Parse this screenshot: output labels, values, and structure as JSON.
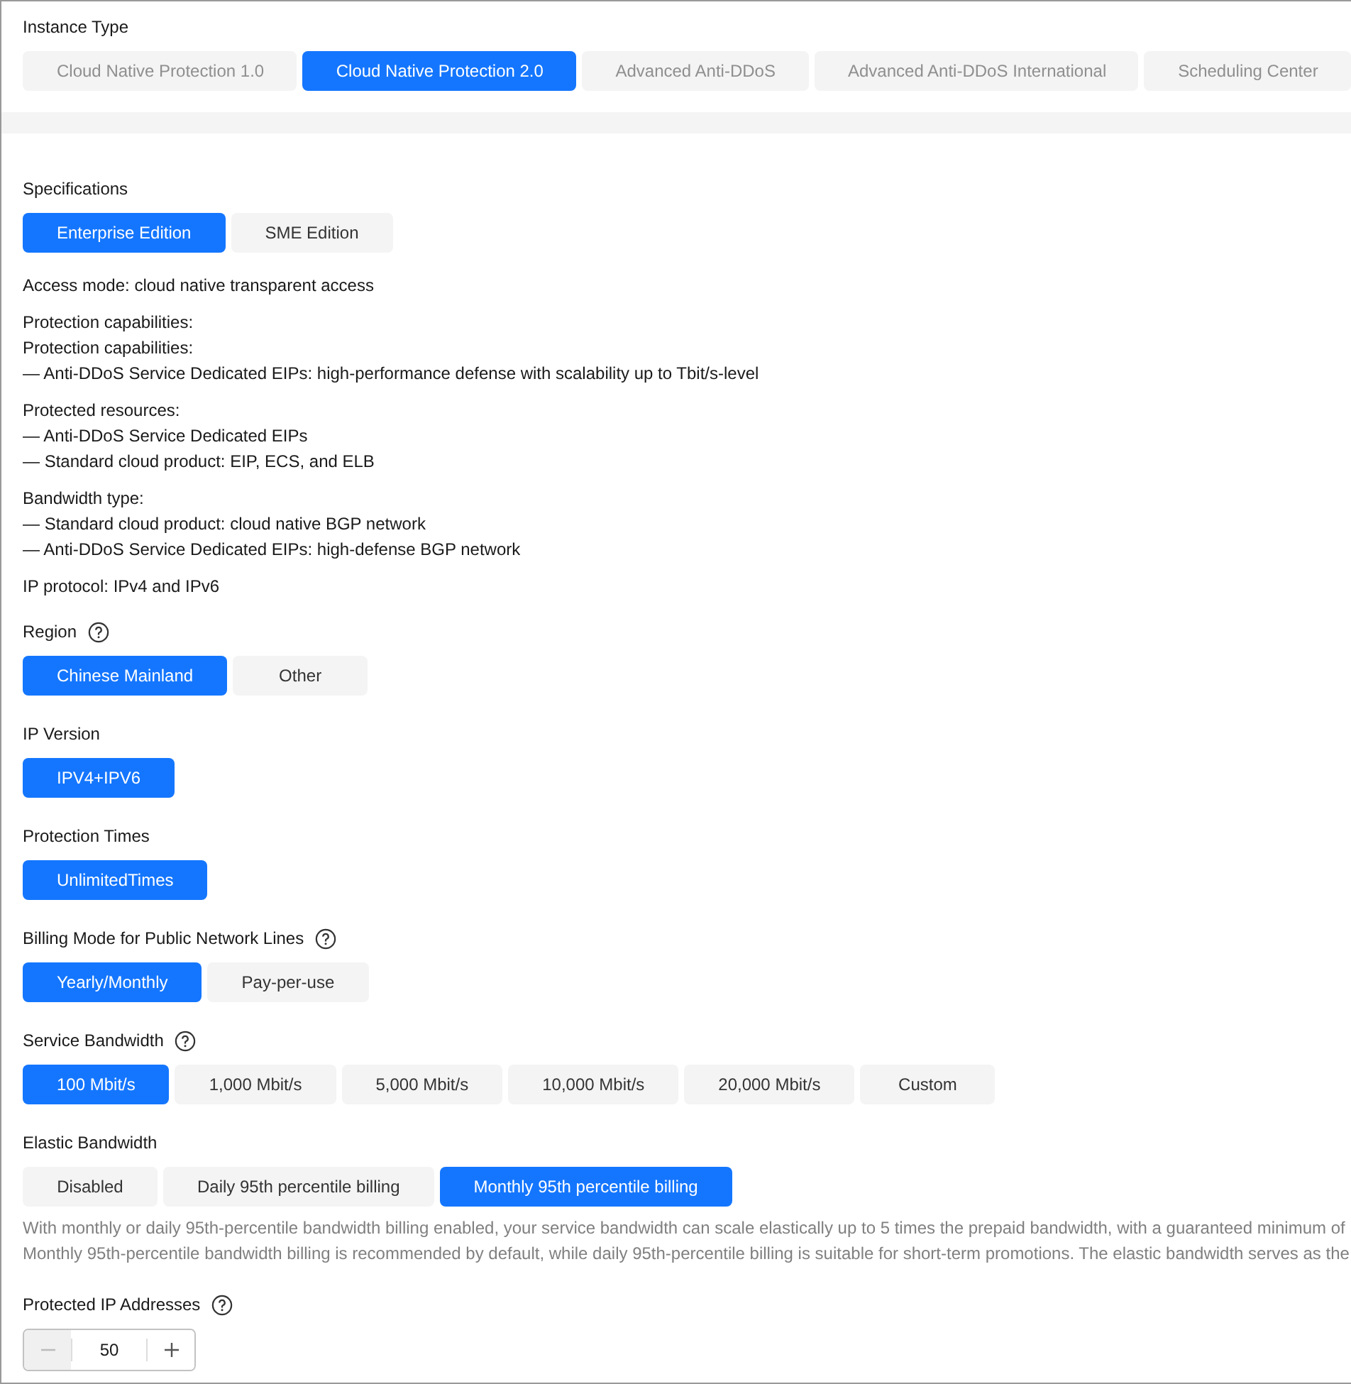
{
  "instance_type": {
    "label": "Instance Type",
    "options": [
      {
        "label": "Cloud Native Protection 1.0",
        "selected": false,
        "disabled": true
      },
      {
        "label": "Cloud Native Protection 2.0",
        "selected": true,
        "disabled": false
      },
      {
        "label": "Advanced Anti-DDoS",
        "selected": false,
        "disabled": true
      },
      {
        "label": "Advanced Anti-DDoS International",
        "selected": false,
        "disabled": true
      },
      {
        "label": "Scheduling Center",
        "selected": false,
        "disabled": true
      }
    ]
  },
  "sections": [
    {
      "kind": "options",
      "label": "Specifications",
      "options": [
        {
          "label": "Enterprise Edition",
          "selected": true
        },
        {
          "label": "SME Edition",
          "selected": false
        }
      ]
    },
    {
      "kind": "info",
      "paragraphs": [
        [
          "Access mode: cloud native transparent access"
        ],
        [
          "Protection capabilities:",
          "Protection capabilities:",
          "— Anti-DDoS Service Dedicated EIPs: high-performance defense with scalability up to Tbit/s-level"
        ],
        [
          "Protected resources:",
          "— Anti-DDoS Service Dedicated EIPs",
          "— Standard cloud product: EIP, ECS, and ELB"
        ],
        [
          "Bandwidth type:",
          "— Standard cloud product: cloud native BGP network",
          "— Anti-DDoS Service Dedicated EIPs: high-defense BGP network"
        ],
        [
          "IP protocol: IPv4 and IPv6"
        ]
      ]
    },
    {
      "kind": "options",
      "label": "Region",
      "help": true,
      "options": [
        {
          "label": "Chinese Mainland",
          "selected": true
        },
        {
          "label": "Other",
          "selected": false
        }
      ]
    },
    {
      "kind": "options",
      "label": "IP Version",
      "options": [
        {
          "label": "IPV4+IPV6",
          "selected": true
        }
      ]
    },
    {
      "kind": "options",
      "label": "Protection Times",
      "options": [
        {
          "label": "UnlimitedTimes",
          "selected": true
        }
      ]
    },
    {
      "kind": "options",
      "label": "Billing Mode for Public Network Lines",
      "help": true,
      "options": [
        {
          "label": "Yearly/Monthly",
          "selected": true
        },
        {
          "label": "Pay-per-use",
          "selected": false
        }
      ]
    },
    {
      "kind": "options",
      "label": "Service Bandwidth",
      "help": true,
      "options": [
        {
          "label": "100 Mbit/s",
          "selected": true
        },
        {
          "label": "1,000 Mbit/s",
          "selected": false
        },
        {
          "label": "5,000 Mbit/s",
          "selected": false
        },
        {
          "label": "10,000 Mbit/s",
          "selected": false
        },
        {
          "label": "20,000 Mbit/s",
          "selected": false
        },
        {
          "label": "Custom",
          "selected": false
        }
      ]
    },
    {
      "kind": "options",
      "label": "Elastic Bandwidth",
      "options": [
        {
          "label": "Disabled",
          "selected": false
        },
        {
          "label": "Daily 95th percentile billing",
          "selected": false
        },
        {
          "label": "Monthly 95th percentile billing",
          "selected": true
        }
      ],
      "note": [
        "With monthly or daily 95th-percentile bandwidth billing enabled, your service bandwidth can scale elastically up to 5 times the prepaid bandwidth, with a guaranteed minimum of",
        "Monthly 95th-percentile bandwidth billing is recommended by default, while daily 95th-percentile billing is suitable for short-term promotions. The elastic bandwidth serves as the"
      ]
    },
    {
      "kind": "stepper",
      "label": "Protected IP Addresses",
      "help": true,
      "value": "50",
      "minus_disabled": true
    }
  ]
}
